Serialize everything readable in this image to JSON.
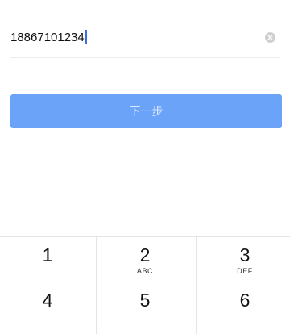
{
  "phone_input": {
    "value": "18867101234",
    "clear_icon": "clear-icon"
  },
  "next_button": {
    "label": "下一步"
  },
  "colors": {
    "button_bg": "#6aa3f7",
    "button_text": "#d9e8fe",
    "caret": "#3d6de0",
    "clear_icon": "#cfcfcf"
  },
  "keypad": {
    "keys": [
      {
        "digit": "1",
        "letters": ""
      },
      {
        "digit": "2",
        "letters": "ABC"
      },
      {
        "digit": "3",
        "letters": "DEF"
      },
      {
        "digit": "4",
        "letters": ""
      },
      {
        "digit": "5",
        "letters": ""
      },
      {
        "digit": "6",
        "letters": ""
      }
    ]
  }
}
